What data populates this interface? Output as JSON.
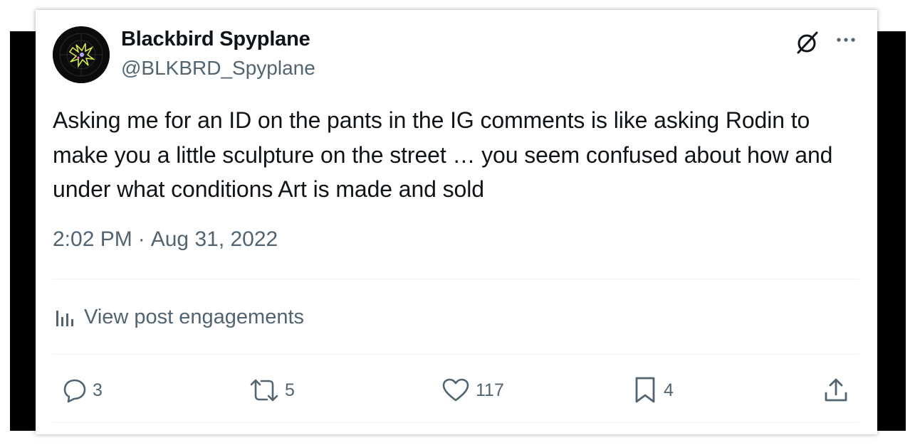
{
  "author": {
    "name": "Blackbird Spyplane",
    "handle": "@BLKBRD_Spyplane"
  },
  "tweet": {
    "text": "Asking me for an ID on the pants in the IG comments is like asking Rodin to make you a little sculpture on the street … you seem confused about how and under what conditions Art is made and sold",
    "time": "2:02 PM",
    "separator": "·",
    "date": "Aug 31, 2022"
  },
  "engagements": {
    "label": "View post engagements",
    "icon": "analytics-icon"
  },
  "actions": {
    "replies": "3",
    "reposts": "5",
    "likes": "117",
    "bookmarks": "4"
  },
  "icons": {
    "grok": "grok-icon",
    "more": "more-icon",
    "reply": "reply-icon",
    "repost": "repost-icon",
    "like": "heart-icon",
    "bookmark": "bookmark-icon",
    "share": "share-icon"
  },
  "colors": {
    "text": "#0f1419",
    "secondary": "#536471",
    "divider": "#eff3f4",
    "backdrop": "#000000",
    "avatar_accent": "#d4e64a"
  }
}
